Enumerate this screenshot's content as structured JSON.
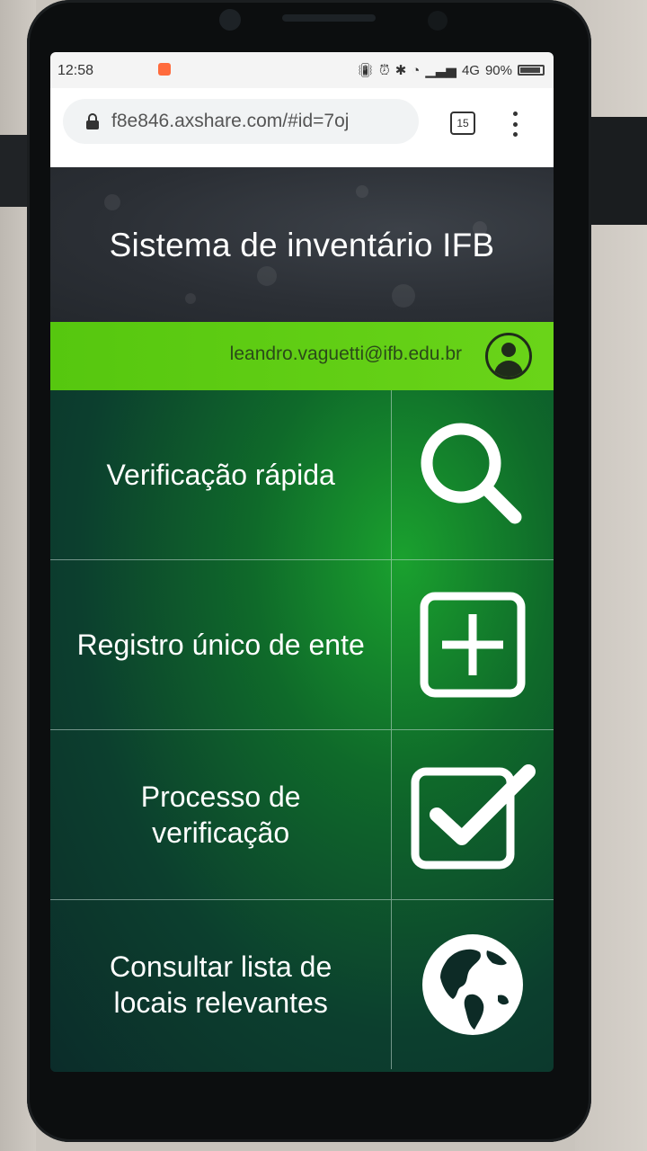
{
  "status_bar": {
    "time": "12:58",
    "network": "4G",
    "battery": "90%"
  },
  "browser": {
    "url": "f8e846.axshare.com/#id=7oj",
    "tab_count": "15"
  },
  "header": {
    "title": "Sistema de inventário IFB"
  },
  "user": {
    "email": "leandro.vaguetti@ifb.edu.br"
  },
  "menu": {
    "items": [
      {
        "label": "Verificação rápida",
        "icon": "search-icon"
      },
      {
        "label": "Registro único de ente",
        "icon": "plus-square-icon"
      },
      {
        "label": "Processo de verificação",
        "icon": "checkbox-icon"
      },
      {
        "label": "Consultar lista de locais relevantes",
        "icon": "globe-icon"
      }
    ]
  },
  "colors": {
    "accent_green": "#5fd113",
    "header_dark": "#2b2f35",
    "menu_green": "#0f6a2a"
  }
}
